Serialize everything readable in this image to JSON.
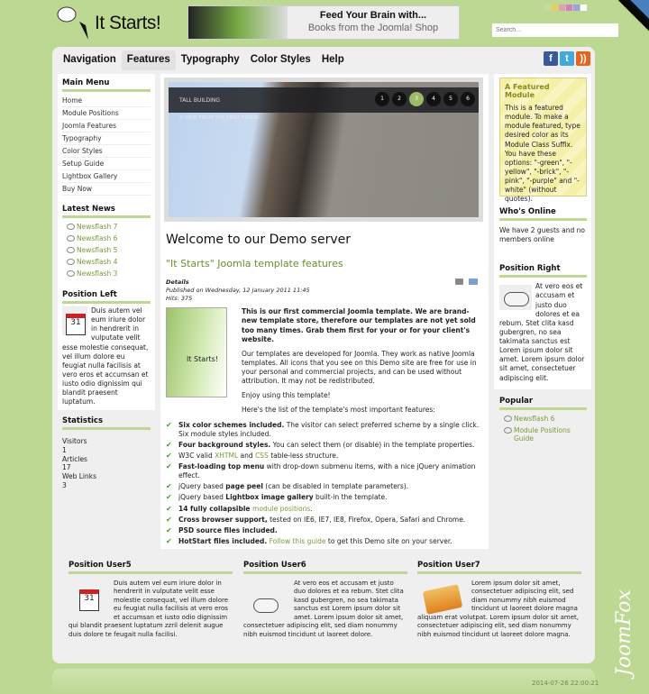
{
  "header": {
    "logo": "It Starts!",
    "banner_line1": "Feed Your Brain with...",
    "banner_line2": "Books from the Joomla! Shop",
    "search_placeholder": "Search...",
    "swatch_colors": [
      "#c8d8a0",
      "#e8d060",
      "#e0a0b0",
      "#d080c0",
      "#a0a0e0",
      "#ffffff"
    ]
  },
  "nav": {
    "items": [
      "Navigation",
      "Features",
      "Typography",
      "Color Styles",
      "Help"
    ],
    "active": "Features",
    "social": [
      "facebook-icon",
      "twitter-icon",
      "rss-icon"
    ]
  },
  "left": {
    "main_menu": {
      "title": "Main Menu",
      "items": [
        "Home",
        "Module Positions",
        "Joomla Features",
        "Typography",
        "Color Styles",
        "Setup Guide",
        "Lightbox Gallery",
        "Buy Now"
      ]
    },
    "latest_news": {
      "title": "Latest News",
      "items": [
        "Newsflash 7",
        "Newsflash 6",
        "Newsflash 5",
        "Newsflash 4",
        "Newsflash 3"
      ]
    },
    "position_left": {
      "title": "Position Left",
      "text": "Duis autem vel eum iriure dolor in hendrerit in vulputate velit esse molestie consequat, vel illum dolore eu feugiat nulla facilisis at vero eros et accumsan et iusto odio dignissim qui blandit praesent luptatum."
    },
    "statistics": {
      "title": "Statistics",
      "lines": [
        "Visitors",
        "1",
        "Articles",
        "17",
        "Web Links",
        "3"
      ]
    }
  },
  "slider": {
    "caption": "TALL BUILDING",
    "subcaption": "A VIEW FROM THE FIRST FLOOR",
    "pages": [
      "1",
      "2",
      "3",
      "4",
      "5",
      "6"
    ],
    "active": "3"
  },
  "article": {
    "title": "Welcome to our Demo server",
    "subtitle": "\"It Starts\" Joomla template features",
    "details": "Details",
    "published": "Published on Wednesday, 12 January 2011 11:45",
    "hits": "Hits: 375",
    "box_label": "It Starts!",
    "p1": "This is our first commercial Joomla template. We are brand-new template store, therefore our templates are not yet sold too many times. Grab them first for your or for your client's website.",
    "p2": "Our templates are developed for Joomla. They work as native Joomla templates. All icons that you see on this Demo site are free for use in your personal and commercial projects, and can be used without attribution. It may not be redistributed.",
    "p3": "Enjoy using this template!",
    "p4": "Here's the list of the template's most important features:",
    "features": [
      {
        "b": "Six color schemes included.",
        "t": " The visitor can select preferred scheme by a single click. Six module styles included."
      },
      {
        "b": "Four background styles.",
        "t": " You can select them (or disable) in the template properties."
      },
      {
        "a": "W3C valid ",
        "l": "XHTML",
        "m": " and ",
        "l2": "CSS",
        "t": " table-less structure."
      },
      {
        "b": "Fast-loading top menu",
        "t": " with drop-down submenu items, with a nice jQuery animation effect."
      },
      {
        "a": "jQuery based ",
        "b": "page peel",
        "t": " (can be disabled in template parameters)."
      },
      {
        "a": "jQuery based ",
        "b": "Lightbox image gallery",
        "t": " built-in the template."
      },
      {
        "b": "14 fully collapsible ",
        "l": "module positions",
        "t": "."
      },
      {
        "b": "Cross browser support,",
        "t": " tested on IE6, IE7, IE8, Firefox, Opera, Safari and Chrome."
      },
      {
        "b": "PSD source files included.",
        "t": ""
      },
      {
        "b": "HotStart files included.",
        "l": " Follow this guide",
        "t": " to get this Demo site on your server."
      }
    ]
  },
  "right": {
    "featured": {
      "title": "A Featured Module",
      "text": "This is a featured module. To make a module featured, type desired color as its Module Class Suffix. You have these options: \"-green\", \"-yellow\", \"-brick\", \"-pink\", \"-purple\" and \"-white\" (without quotes)."
    },
    "whos_online": {
      "title": "Who's Online",
      "text": "We have 2 guests and no members online"
    },
    "position_right": {
      "title": "Position Right",
      "text": "At vero eos et accusam et justo duo dolores et ea rebum. Stet clita kasd gubergren, no sea takimata sanctus est Lorem ipsum dolor sit amet. Lorem ipsum dolor sit amet, consectetuer adipiscing elit."
    },
    "popular": {
      "title": "Popular",
      "items": [
        "Newsflash 6",
        "Module Positions Guide"
      ]
    }
  },
  "bottom": [
    {
      "title": "Position User5",
      "text": "Duis autem vel eum iriure dolor in hendrerit in vulputate velit esse molestie consequat, vel illum dolore eu feugiat nulla facilisis at vero eros et accumsan et iusto odio dignissim qui blandit praesent luptatum zzril delenit augue duis dolore te feugait nulla facilisi."
    },
    {
      "title": "Position User6",
      "text": "At vero eos et accusam et justo duo dolores et ea rebum. Stet clita kasd gubergren, no sea takimata sanctus est Lorem ipsum dolor sit amet. Lorem ipsum dolor sit amet, consectetuer adipiscing elit, sed diam nonummy nibh euismod tincidunt ut laoreet dolore."
    },
    {
      "title": "Position User7",
      "text": "Lorem ipsum dolor sit amet, consectetuer adipiscing elit, sed diam nonummy nibh euismod tincidunt ut laoreet dolore magna aliquam erat volutpat. Lorem ipsum dolor sit amet, consectetuer adipiscing elit, sed diam nonummy nibh euismod tincidunt ut laoreet dolore magna."
    }
  ],
  "footer": {
    "timestamp": "2014-07-26 22:00:21",
    "brand": "JoomFox"
  }
}
